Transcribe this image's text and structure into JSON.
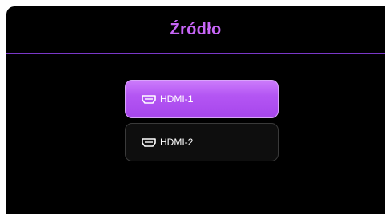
{
  "osd": {
    "title": "Źródło",
    "title_color": "#c766f7",
    "divider_color": "#7a38c8",
    "selected_color": "#b456f3"
  },
  "sources": [
    {
      "icon": "hdmi-port-icon",
      "prefix": "HDMI-",
      "number": "1",
      "selected": true
    },
    {
      "icon": "hdmi-port-icon",
      "prefix": "HDMI-",
      "number": "2",
      "selected": false
    }
  ]
}
